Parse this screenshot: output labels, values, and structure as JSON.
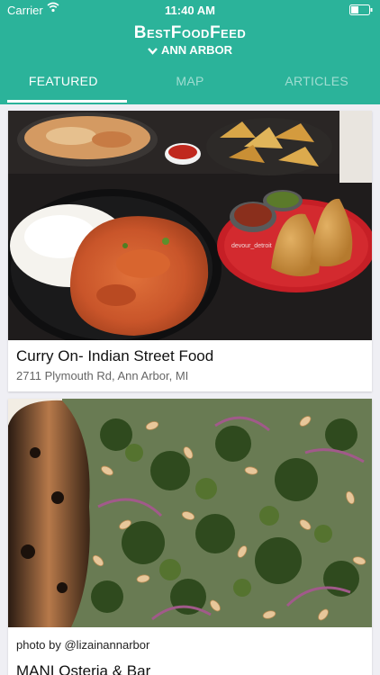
{
  "status_bar": {
    "carrier": "Carrier",
    "time": "11:40 AM"
  },
  "header": {
    "brand": "BestFoodFeed",
    "city": "ANN ARBOR"
  },
  "tabs": [
    {
      "label": "FEATURED",
      "active": true
    },
    {
      "label": "MAP",
      "active": false
    },
    {
      "label": "ARTICLES",
      "active": false
    }
  ],
  "cards": [
    {
      "title": "Curry On- Indian Street Food",
      "address": "2711 Plymouth Rd, Ann Arbor, MI",
      "watermark": "devour_detroit"
    },
    {
      "credit": "photo by @lizainannarbor",
      "title": "MANI Osteria & Bar"
    }
  ],
  "colors": {
    "accent": "#2bb39a",
    "background": "#efeff4"
  }
}
